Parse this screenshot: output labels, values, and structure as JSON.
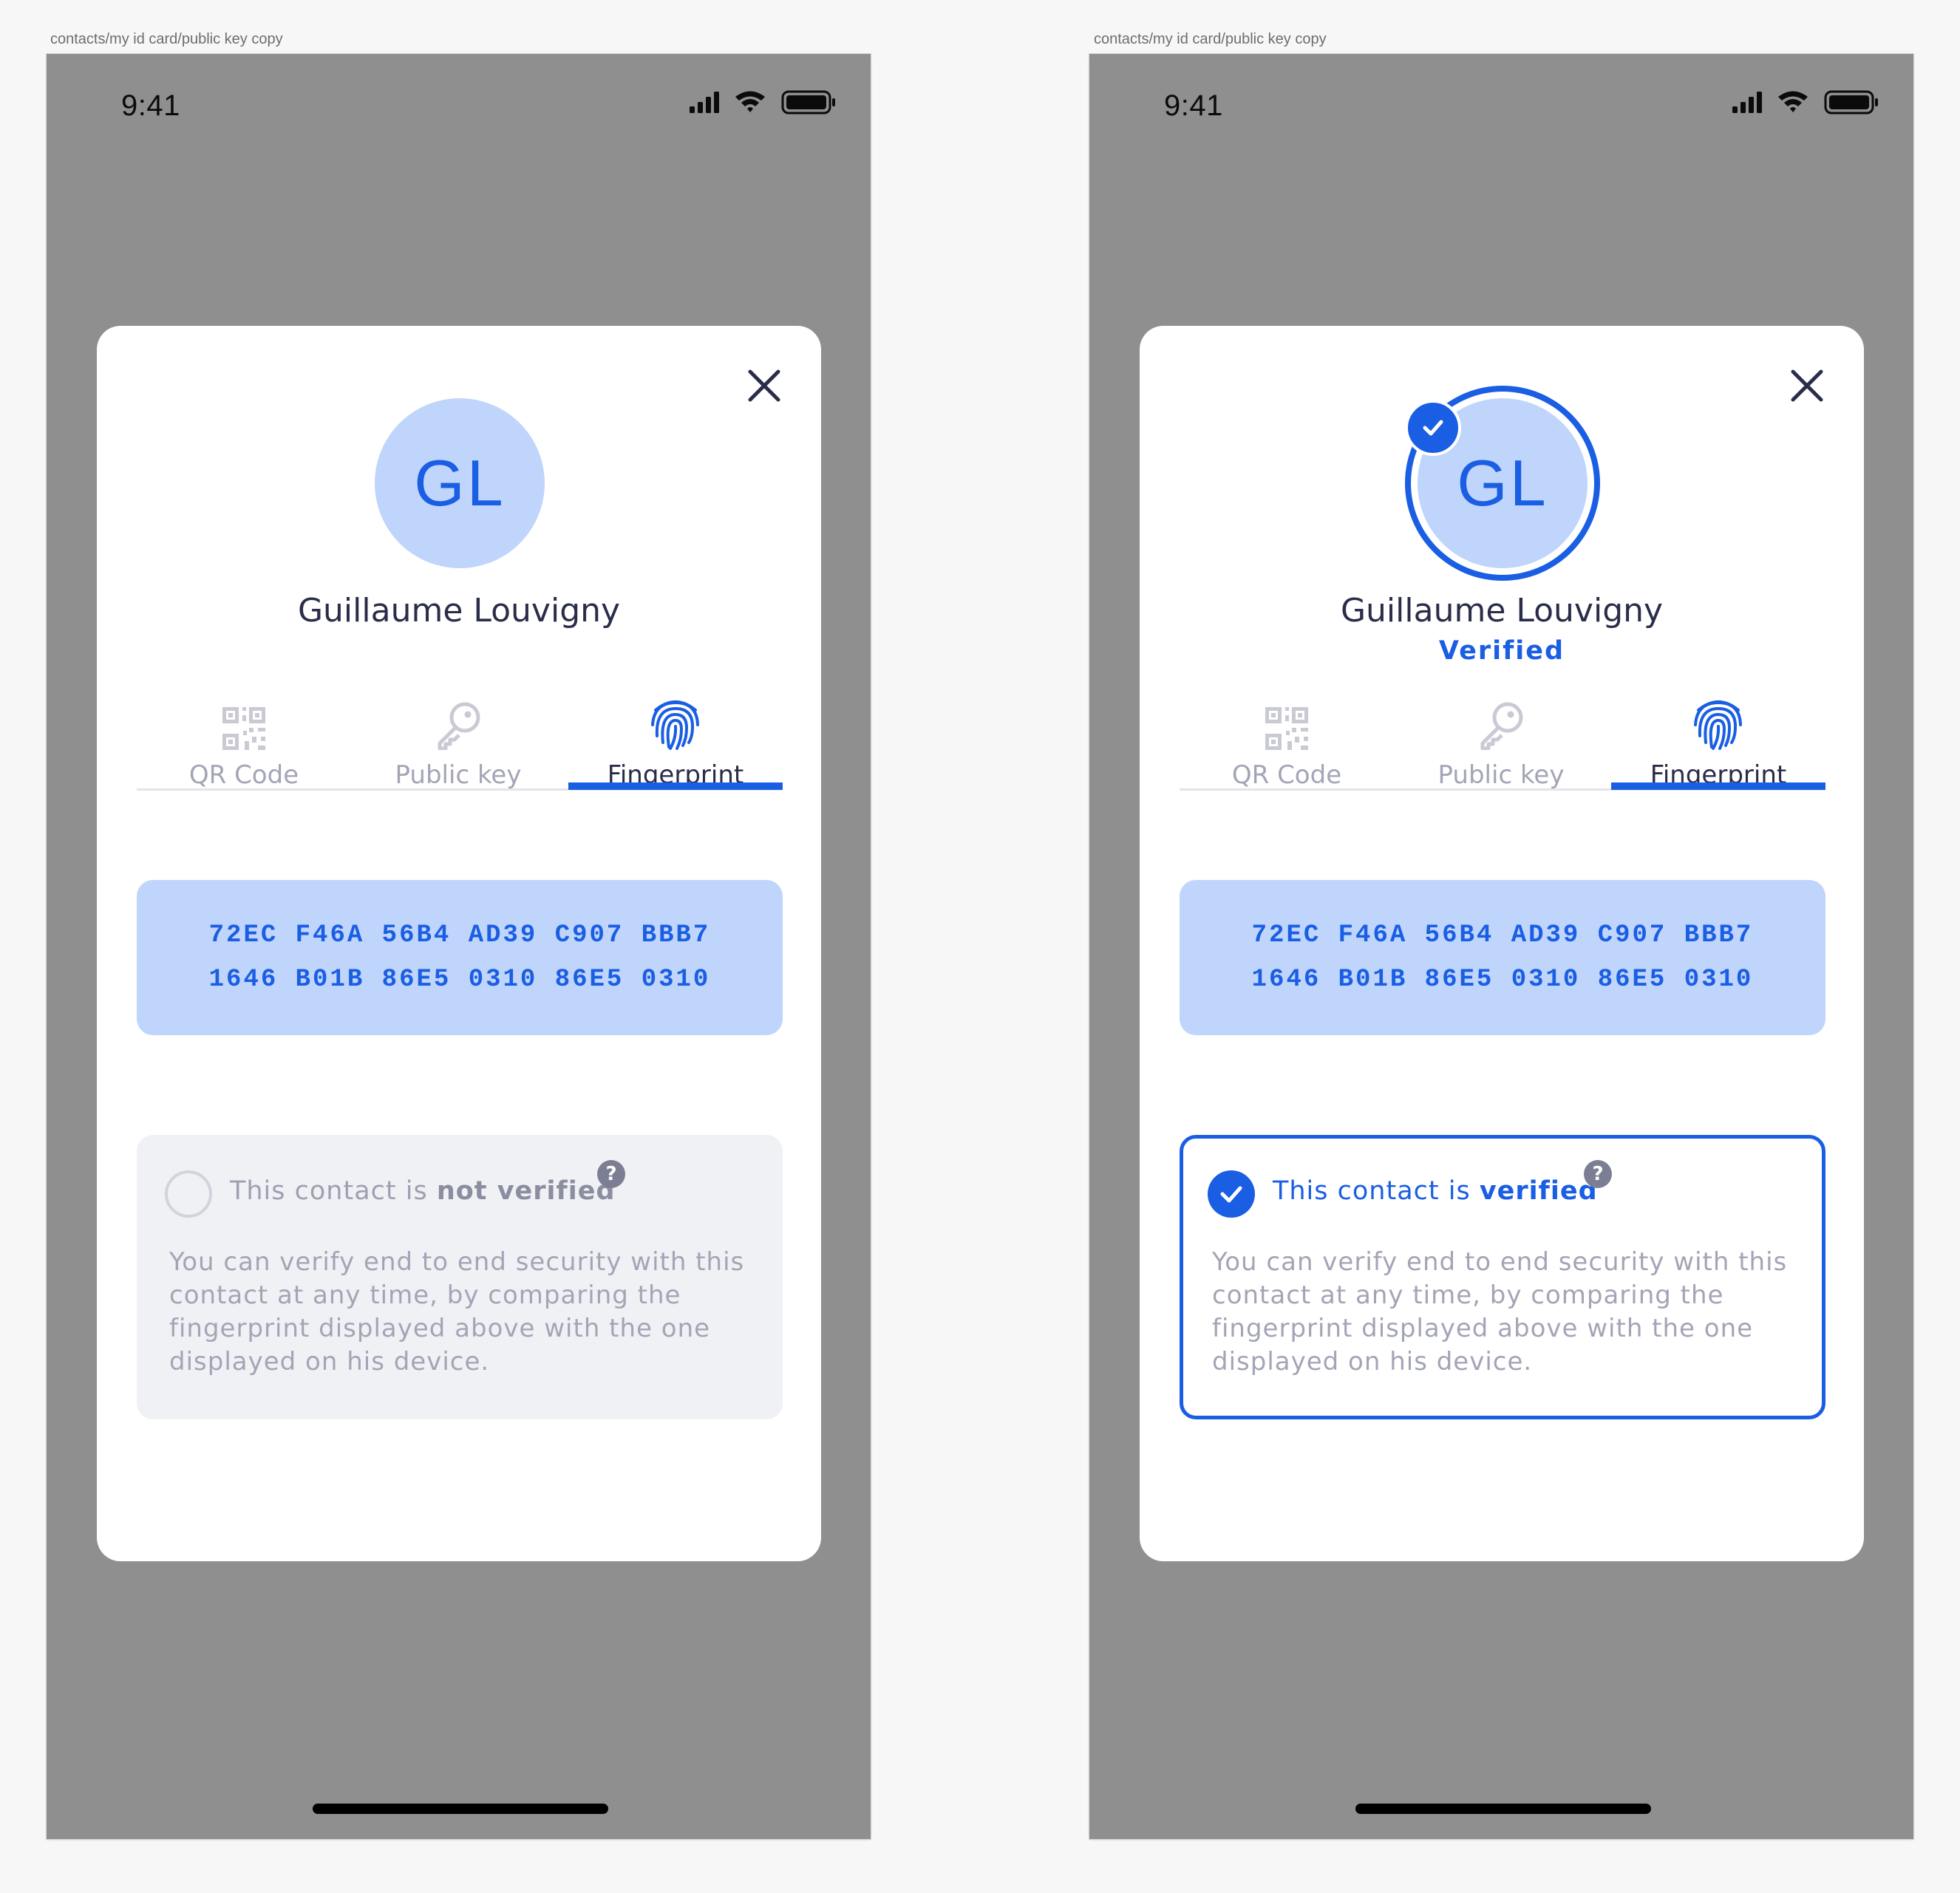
{
  "frame_label": "contacts/my id card/public key copy",
  "status_time": "9:41",
  "colors": {
    "accent": "#1a5ee4",
    "avatar_bg": "#c0d5fb",
    "overlay_bg": "#8f8f8f",
    "text_dark": "#2a2d4a",
    "text_muted": "#a3a5b6"
  },
  "icons": {
    "close": "close-icon",
    "qr": "qr-code-icon",
    "key": "key-icon",
    "fingerprint": "fingerprint-icon",
    "check": "check-icon",
    "help": "question-mark-icon",
    "status_bar": [
      "signal-icon",
      "wifi-icon",
      "battery-icon"
    ]
  },
  "contact": {
    "initials": "GL",
    "name": "Guillaume Louvigny",
    "verified_label": "Verified"
  },
  "tabs": [
    {
      "label": "QR Code",
      "active": false
    },
    {
      "label": "Public key",
      "active": false
    },
    {
      "label": "Fingerprint",
      "active": true
    }
  ],
  "fingerprint": {
    "line1": "72EC F46A 56B4 AD39 C907 BBB7",
    "line2": "1646 B01B 86E5 0310 86E5 0310"
  },
  "verification": {
    "prefix": "This contact is ",
    "not_verified": "not verified",
    "verified": "verified",
    "help": "?",
    "description": "You can verify end to end security with this contact at any time, by comparing the fingerprint displayed above with the one displayed on his device."
  }
}
